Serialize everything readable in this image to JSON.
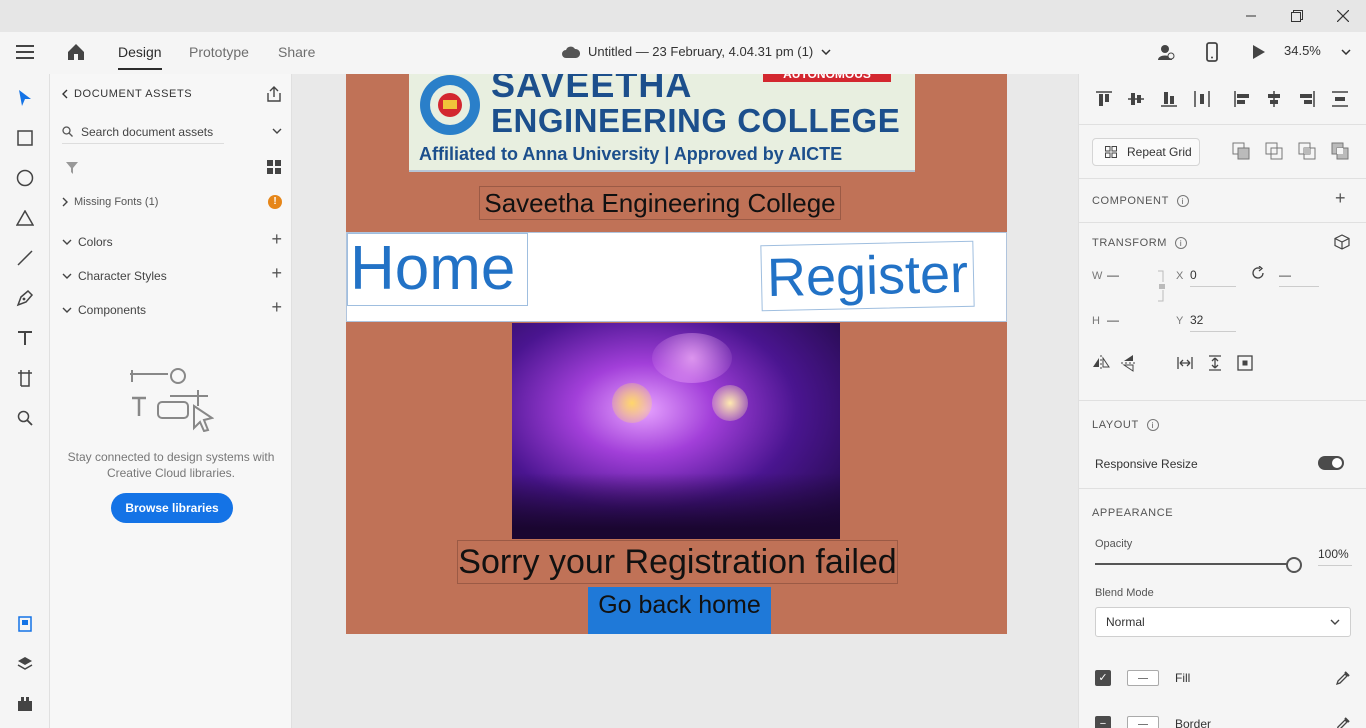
{
  "header": {
    "tabs": [
      "Design",
      "Prototype",
      "Share"
    ],
    "document_title": "Untitled — 23 February, 4.04.31 pm (1)",
    "zoom": "34.5%"
  },
  "assets": {
    "title": "DOCUMENT ASSETS",
    "search_placeholder": "Search document assets",
    "missing_fonts": "Missing Fonts (1)",
    "sections": [
      "Colors",
      "Character Styles",
      "Components"
    ],
    "empty_text": "Stay connected to design systems with Creative Cloud libraries.",
    "browse_button": "Browse libraries"
  },
  "artboard": {
    "logo_line1": "SAVEETHA",
    "logo_line2": "ENGINEERING COLLEGE",
    "logo_line3": "Affiliated to Anna University | Approved by AICTE",
    "logo_badge": "AUTONOMOUS",
    "college_name": "Saveetha Engineering College",
    "nav_home": "Home",
    "nav_register": "Register",
    "message": "Sorry your Registration failed",
    "go_back": "Go back home"
  },
  "properties": {
    "repeat_grid": "Repeat Grid",
    "component_label": "COMPONENT",
    "transform_label": "TRANSFORM",
    "w_label": "W",
    "w_value": "—",
    "h_label": "H",
    "h_value": "—",
    "x_label": "X",
    "x_value": "0",
    "y_label": "Y",
    "y_value": "32",
    "rotation_value": "—",
    "layout_label": "LAYOUT",
    "responsive_resize": "Responsive Resize",
    "appearance_label": "APPEARANCE",
    "opacity_label": "Opacity",
    "opacity_value": "100%",
    "opacity_fraction": 1.0,
    "blend_mode_label": "Blend Mode",
    "blend_mode_value": "Normal",
    "fill_label": "Fill",
    "border_label": "Border"
  }
}
